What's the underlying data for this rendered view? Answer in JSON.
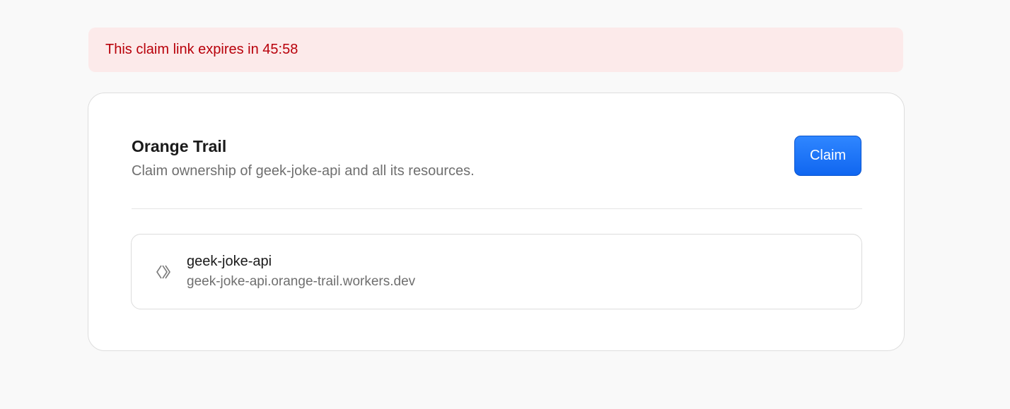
{
  "banner": {
    "text": "This claim link expires in 45:58",
    "color": "#b8000a",
    "background": "#fceaea"
  },
  "card": {
    "title": "Orange Trail",
    "subtitle": "Claim ownership of geek-joke-api and all its resources.",
    "claim_label": "Claim",
    "accent": "#1a73ff"
  },
  "resource": {
    "icon": "worker-icon",
    "name": "geek-joke-api",
    "url": "geek-joke-api.orange-trail.workers.dev"
  }
}
